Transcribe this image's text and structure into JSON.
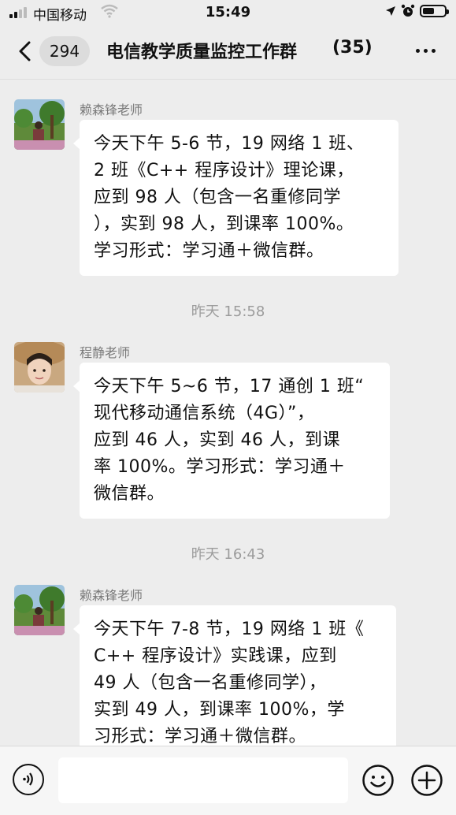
{
  "status_bar": {
    "carrier": "中国移动",
    "time": "15:49"
  },
  "nav": {
    "back_icon": "chevron-left-icon",
    "unread_count": "294",
    "title": "电信教学质量监控工作群",
    "member_count": "(35)",
    "more_icon": "ellipsis-icon"
  },
  "messages": [
    {
      "sender": "赖森锋老师",
      "avatar": "avatar-garden-photo",
      "lines": [
        "今天下午 5-6 节，19 网络 1 班、",
        "2 班《C++ 程序设计》理论课，",
        "应到 98 人（包含一名重修同学",
        "），实到 98 人，到课率 100%。",
        "学习形式：学习通＋微信群。"
      ]
    },
    {
      "time_divider": "昨天 15:58",
      "sender": "程静老师",
      "avatar": "avatar-portrait-photo",
      "lines": [
        "今天下午 5~6 节，17 通创 1 班“",
        "现代移动通信系统（4G）”，",
        "应到 46 人，实到 46 人，到课",
        "率 100%。学习形式：学习通＋",
        "微信群。"
      ]
    },
    {
      "time_divider": "昨天 16:43",
      "sender": "赖森锋老师",
      "avatar": "avatar-garden-photo",
      "lines": [
        "今天下午 7-8 节，19 网络 1 班《",
        "C++ 程序设计》实践课，应到",
        "49 人（包含一名重修同学），",
        "实到 49 人，到课率 100%，学",
        "习形式：学习通＋微信群。"
      ]
    }
  ],
  "input_bar": {
    "voice_icon": "voice-icon",
    "emoji_icon": "emoji-icon",
    "plus_icon": "plus-icon",
    "placeholder": ""
  },
  "colors": {
    "background": "#ededed",
    "bubble": "#ffffff",
    "sender_name": "#7a7a7a",
    "timestamp": "#9c9c9c"
  }
}
